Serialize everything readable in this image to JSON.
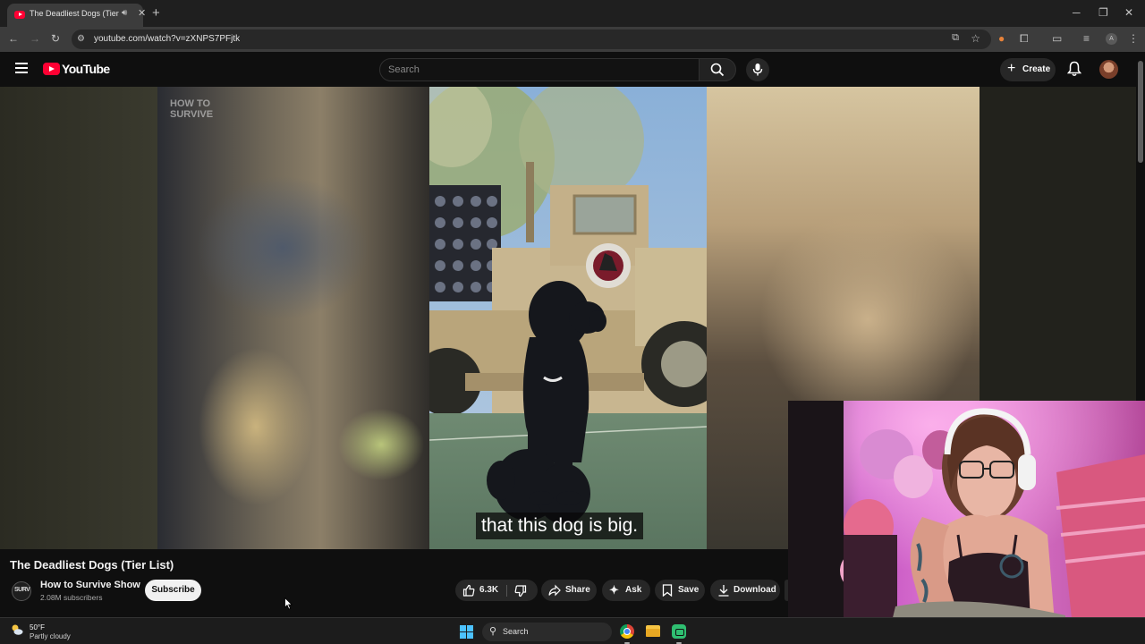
{
  "browser": {
    "tab_title": "The Deadliest Dogs (Tier List)",
    "url": "youtube.com/watch?v=zXNPS7PFjtk",
    "colors": {
      "tab_strip": "#1f1f1f",
      "toolbar": "#3c3c3c"
    }
  },
  "youtube": {
    "logo_text": "YouTube",
    "search_placeholder": "Search",
    "create_label": "Create",
    "colors": {
      "brand": "#ff0033",
      "background": "#0f0f0f"
    }
  },
  "video": {
    "watermark_line1": "HOW TO",
    "watermark_line2": "SURVIVE",
    "caption": "that this dog is big.",
    "title": "The Deadliest Dogs (Tier List)"
  },
  "channel": {
    "name": "How to Survive Show",
    "subscribers": "2.08M subscribers",
    "avatar_text": "SURV",
    "subscribe_label": "Subscribe"
  },
  "actions": {
    "likes": "6.3K",
    "share": "Share",
    "ask": "Ask",
    "save": "Save",
    "download": "Download"
  },
  "taskbar": {
    "temperature": "50°F",
    "condition": "Partly cloudy",
    "search_label": "Search"
  },
  "icons": [
    "youtube-favicon",
    "speaker-icon",
    "close-icon",
    "plus-icon",
    "back-arrow-icon",
    "forward-arrow-icon",
    "reload-icon",
    "site-info-icon",
    "cast-icon",
    "star-icon",
    "extension-icon",
    "menu-icon",
    "search-icon",
    "mic-icon",
    "bell-icon",
    "thumbs-up-icon",
    "thumbs-down-icon",
    "share-icon",
    "ask-sparkle-icon",
    "bookmark-icon",
    "download-icon",
    "weather-icon",
    "windows-start-icon",
    "chrome-icon",
    "file-explorer-icon",
    "app-icon",
    "mouse-cursor-icon"
  ]
}
